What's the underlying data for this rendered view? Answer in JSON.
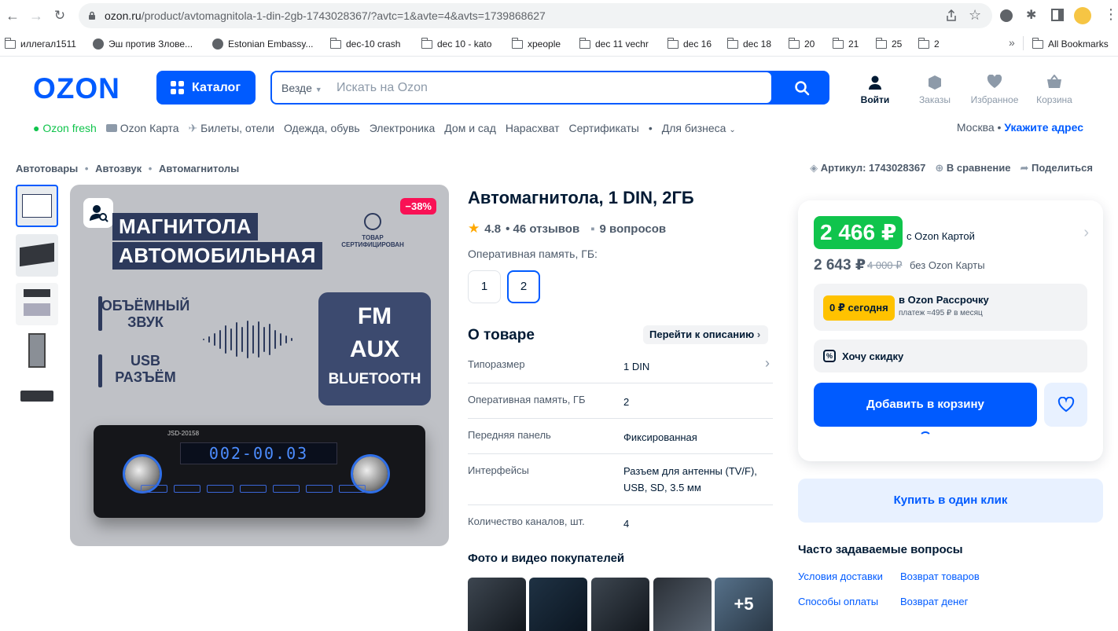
{
  "browser": {
    "url_host": "ozon.ru",
    "url_path": "/product/avtomagnitola-1-din-2gb-1743028367/?avtc=1&avte=4&avts=1739868627",
    "bookmarks": [
      "иллегал1511",
      "Эш против Злове...",
      "Estonian Embassy...",
      "dec-10 crash",
      "dec 10 - kato",
      "xpeople",
      "dec 11 vechr",
      "dec 16",
      "dec 18",
      "20",
      "21",
      "25",
      "2"
    ],
    "all_bookmarks": "All Bookmarks",
    "overflow": "»"
  },
  "header": {
    "logo": "OZON",
    "catalog": "Каталог",
    "search_scope": "Везде",
    "search_placeholder": "Искать на Ozon",
    "actions": [
      "Войти",
      "Заказы",
      "Избранное",
      "Корзина"
    ]
  },
  "subnav": {
    "items": [
      "Ozon fresh",
      "Ozon Карта",
      "Билеты, отели",
      "Одежда, обувь",
      "Электроника",
      "Дом и сад",
      "Нарасхват",
      "Сертификаты",
      "•",
      "Для бизнеса"
    ],
    "city": "Москва",
    "city_sep": " • ",
    "address": "Укажите адрес"
  },
  "breadcrumbs": [
    "Автотовары",
    "Автозвук",
    "Автомагнитолы"
  ],
  "meta": {
    "article": "Артикул: 1743028367",
    "compare": "В сравнение",
    "share": "Поделиться"
  },
  "image": {
    "discount": "−38%",
    "title_lines": [
      "МАГНИТОЛА",
      "АВТОМОБИЛЬНАЯ"
    ],
    "cert": "ТОВАР СЕРТИФИЦИРОВАН",
    "feature1": "ОБЪЁМНЫЙ ЗВУК",
    "feature2": "USB РАЗЪЁМ",
    "fm_lines": [
      "FM",
      "AUX",
      "BLUETOOTH"
    ],
    "model": "JSD-20158",
    "lcd": "002-00.03"
  },
  "product": {
    "title": "Автомагнитола, 1 DIN, 2ГБ",
    "rating": "4.8",
    "reviews": "• 46 отзывов",
    "questions": "9 вопросов",
    "ram_label": "Оперативная память, ГБ:",
    "ram_options": [
      "1",
      "2"
    ],
    "about_title": "О товаре",
    "goto_desc": "Перейти к описанию",
    "specs": [
      {
        "k": "Типоразмер",
        "v": "1 DIN"
      },
      {
        "k": "Оперативная память, ГБ",
        "v": "2"
      },
      {
        "k": "Передняя панель",
        "v": "Фиксированная"
      },
      {
        "k": "Интерфейсы",
        "v": "Разъем для антенны (TV/F), USB, SD, 3.5 мм"
      },
      {
        "k": "Количество каналов, шт.",
        "v": "4"
      }
    ],
    "photos_title": "Фото и видео покупателей",
    "photos_more": "+5"
  },
  "buy": {
    "price_card": "2 466 ₽",
    "price_card_note": "с Ozon Картой",
    "price": "2 643 ₽",
    "price_old": "4 000 ₽",
    "price_note": "без Ozon Карты",
    "inst_badge": "0 ₽ сегодня",
    "inst_title": "в Ozon Рассрочку",
    "inst_sub": "платеж ≈495 ₽ в месяц",
    "want_discount": "Хочу скидку",
    "add_to_cart": "Добавить в корзину",
    "one_click": "Купить в один клик"
  },
  "faq": {
    "title": "Часто задаваемые вопросы",
    "links": [
      "Условия доставки",
      "Возврат товаров",
      "Способы оплаты",
      "Возврат денег"
    ]
  },
  "colors": {
    "brand": "#005bff",
    "green": "#10c44c",
    "discount": "#f91155",
    "installment": "#ffc200"
  }
}
